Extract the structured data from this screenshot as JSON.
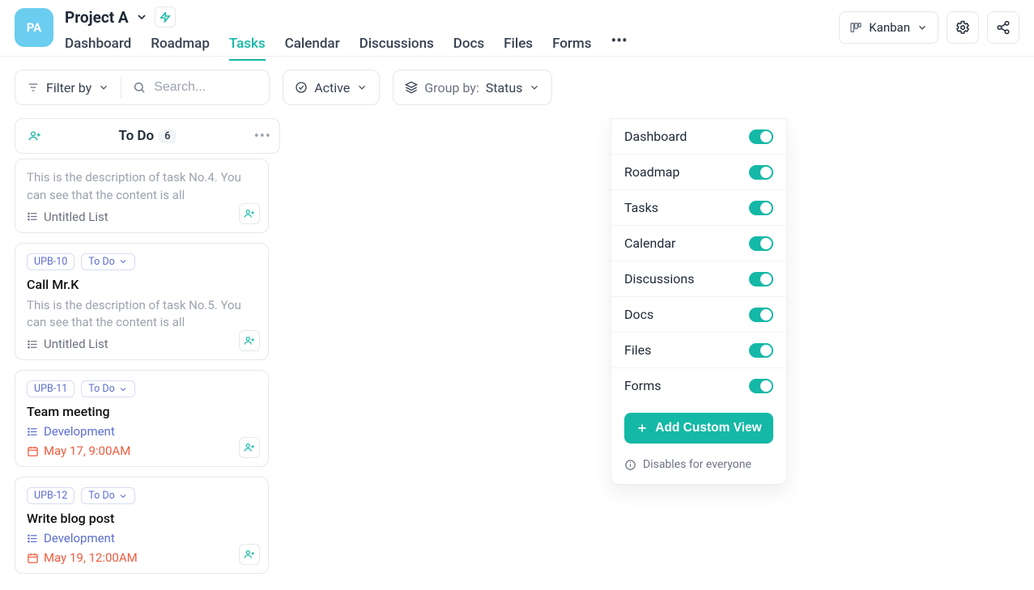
{
  "project": {
    "initials": "PA",
    "title": "Project A"
  },
  "nav": {
    "tabs": [
      "Dashboard",
      "Roadmap",
      "Tasks",
      "Calendar",
      "Discussions",
      "Docs",
      "Files",
      "Forms"
    ],
    "active_index": 2
  },
  "header_right": {
    "view_label": "Kanban"
  },
  "toolbar": {
    "filter_label": "Filter by",
    "search_placeholder": "Search...",
    "active_label": "Active",
    "group_by_label": "Group by:",
    "group_by_value": "Status"
  },
  "column": {
    "title": "To Do",
    "count": "6"
  },
  "cards": [
    {
      "id": null,
      "status": null,
      "title": null,
      "desc": "This is the description of task No.4. You can see that the content is all",
      "list": "Untitled List",
      "date": null
    },
    {
      "id": "UPB-10",
      "status": "To Do",
      "title": "Call Mr.K",
      "desc": "This is the description of task No.5. You can see that the content is all",
      "list": "Untitled List",
      "date": null
    },
    {
      "id": "UPB-11",
      "status": "To Do",
      "title": "Team meeting",
      "desc": null,
      "list": "Development",
      "date": "May 17, 9:00AM"
    },
    {
      "id": "UPB-12",
      "status": "To Do",
      "title": "Write blog post",
      "desc": null,
      "list": "Development",
      "date": "May 19, 12:00AM"
    }
  ],
  "dropdown": {
    "items": [
      "Dashboard",
      "Roadmap",
      "Tasks",
      "Calendar",
      "Discussions",
      "Docs",
      "Files",
      "Forms"
    ],
    "add_label": "Add Custom View",
    "footnote": "Disables for everyone"
  }
}
